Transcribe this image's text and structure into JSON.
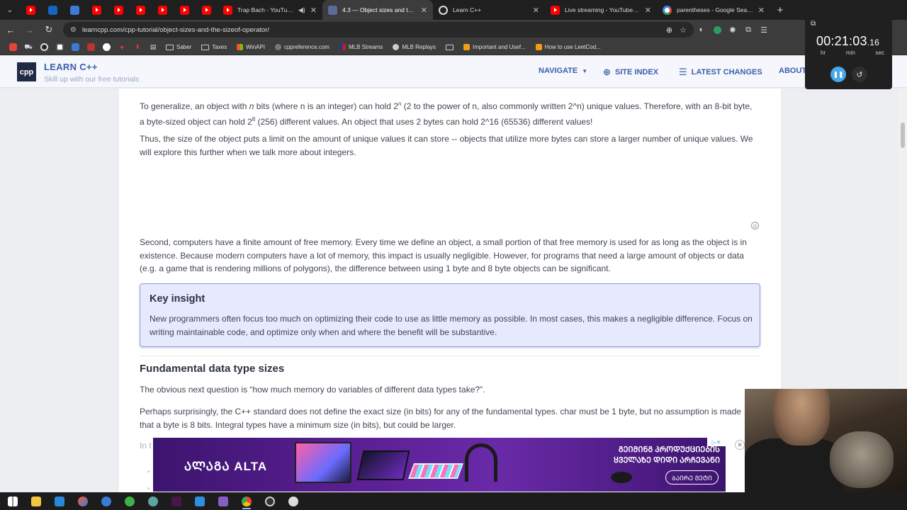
{
  "browser": {
    "tabs": [
      {
        "title": "Trap Bach - YouTube",
        "icon": "youtube-icon",
        "audio": true
      },
      {
        "title": "4.3 — Object sizes and the size",
        "icon": "learncpp-icon",
        "active": true
      },
      {
        "title": "Learn C++",
        "icon": "github-icon"
      },
      {
        "title": "Live streaming - YouTube Studio",
        "icon": "youtube-icon"
      },
      {
        "title": "parentheses - Google Search",
        "icon": "google-icon"
      }
    ],
    "url": "learncpp.com/cpp-tutorial/object-sizes-and-the-sizeof-operator/",
    "bookmarks": [
      "Saber",
      "Taxes",
      "WinAPI",
      "cppreference.com",
      "MLB Streams",
      "MLB Replays",
      "Important and Usef...",
      "How to use LeetCod..."
    ]
  },
  "site": {
    "logo": "cpp",
    "brand": "LEARN C++",
    "tagline": "Skill up with our free tutorials",
    "nav": {
      "navigate": "NAVIGATE",
      "site_index": "SITE INDEX",
      "latest_changes": "LATEST CHANGES",
      "about": "ABOUT"
    }
  },
  "article": {
    "p1a": "To generalize, an object with ",
    "p1n": "n",
    "p1b": " bits (where n is an integer) can hold 2",
    "p1sup1": "n",
    "p1c": " (2 to the power of n, also commonly written 2^n) unique values. Therefore, with an 8-bit byte, a byte-sized object can hold 2",
    "p1sup2": "8",
    "p1d": " (256) different values. An object that uses 2 bytes can hold 2^16 (65536) different values!",
    "p2": "Thus, the size of the object puts a limit on the amount of unique values it can store -- objects that utilize more bytes can store a larger number of unique values. We will explore this further when we talk more about integers.",
    "p3": "Second, computers have a finite amount of free memory. Every time we define an object, a small portion of that free memory is used for as long as the object is in existence. Because modern computers have a lot of memory, this impact is usually negligible. However, for programs that need a large amount of objects or data (e.g. a game that is rendering millions of polygons), the difference between using 1 byte and 8 byte objects can be significant.",
    "insight_title": "Key insight",
    "insight_body": "New programmers often focus too much on optimizing their code to use as little memory as possible. In most cases, this makes a negligible difference. Focus on writing maintainable code, and optimize only when and where the benefit will be substantive.",
    "section_title": "Fundamental data type sizes",
    "p4": "The obvious next question is “how much memory do variables of different data types take?”.",
    "p5": "Perhaps surprisingly, the C++ standard does not define the exact size (in bits) for any of the fundamental types. char must be 1 byte, but no assumption is made that a byte is 8 bits. Integral types have a minimum size (in bits), but could be larger.",
    "p6_partial": "In t"
  },
  "ad": {
    "brand": "ᲐᲚᲐᲒᲐ ALTA",
    "headline_line1": "ᲒᲔᲘᲛᲘᲜᲒ ᲞᲠᲝᲓᲣᲥᲪᲘᲔᲑᲘᲡ",
    "headline_line2": "ᲧᲕᲔᲚᲐᲖᲔ ᲓᲘᲓᲘ ᲐᲠᲩᲔᲕᲐᲜᲘ",
    "cta": "ᲑᲐᲘᲠᲔ ᲛᲔᲢᲘ"
  },
  "timer": {
    "time_main": "00:21:03",
    "time_frac": ".16",
    "hr": "hr",
    "min": "min",
    "sec": "sec"
  },
  "colors": {
    "brand_blue": "#3a5eab",
    "insight_bg": "#e7e9fd",
    "insight_border": "#8d97e3",
    "text": "#3f4653"
  }
}
